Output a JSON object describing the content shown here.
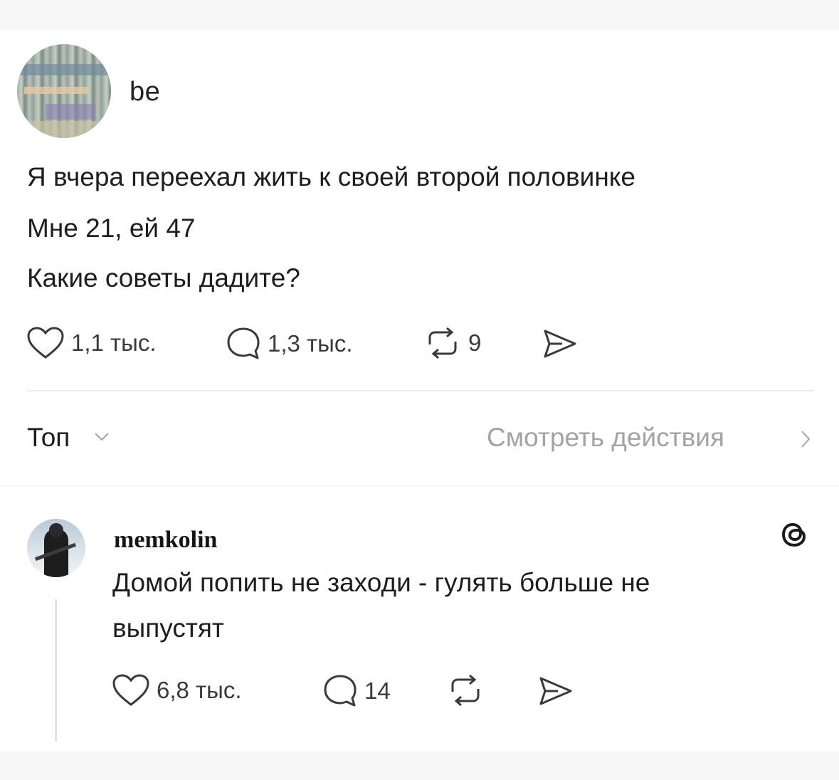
{
  "post": {
    "username": "be",
    "lines": [
      "Я вчера переехал жить к своей второй половинке",
      "Мне 21, ей 47",
      "Какие советы дадите?"
    ],
    "likes": "1,1 тыс.",
    "comments": "1,3 тыс.",
    "reposts": "9"
  },
  "sort_bar": {
    "sort_label": "Топ",
    "activity_label": "Смотреть действия"
  },
  "reply": {
    "username": "memkolin",
    "lines": [
      "Домой попить не заходи - гулять больше не",
      "выпустят"
    ],
    "likes": "6,8 тыс.",
    "comments": "14"
  },
  "icons": {
    "like": "heart-icon",
    "comment": "comment-bubble-icon",
    "repost": "repost-icon",
    "share": "send-icon",
    "threads": "threads-logo-icon",
    "chevron_down": "chevron-down-icon",
    "chevron_right": "chevron-right-icon"
  },
  "colors": {
    "text": "#1e1e1e",
    "muted": "#a3a3a3",
    "divider": "#ececec",
    "background": "#ffffff"
  }
}
